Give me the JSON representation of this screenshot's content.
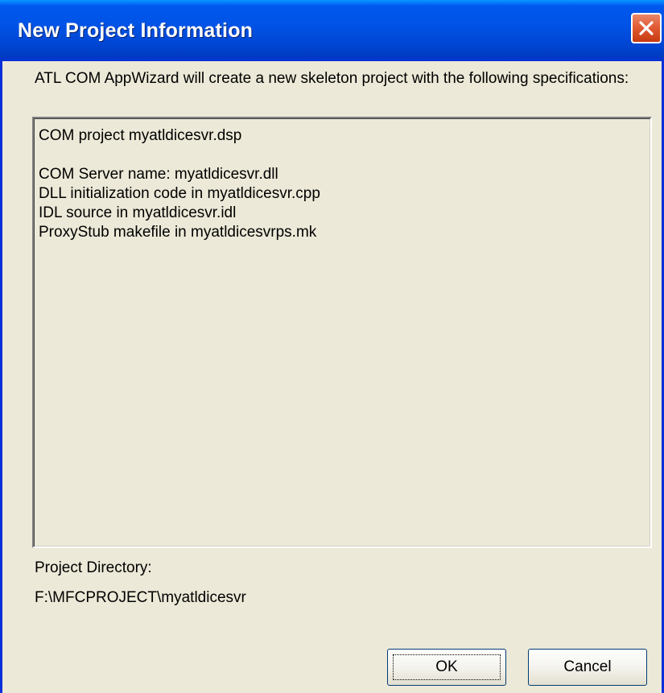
{
  "window": {
    "title": "New Project Information",
    "close_icon": "close-icon"
  },
  "intro_text": "ATL COM AppWizard will create a new skeleton project with the following specifications:",
  "specifications": {
    "lines": [
      "COM project myatldicesvr.dsp",
      "",
      "COM Server name: myatldicesvr.dll",
      "DLL initialization code in myatldicesvr.cpp",
      "IDL source in myatldicesvr.idl",
      "ProxyStub makefile in myatldicesvrps.mk"
    ]
  },
  "project_directory": {
    "label": "Project Directory:",
    "value": "F:\\MFCPROJECT\\myatldicesvr"
  },
  "buttons": {
    "ok_label": "OK",
    "cancel_label": "Cancel"
  },
  "colors": {
    "title_bar": "#0054e3",
    "dialog_background": "#ece9d8",
    "close_button": "#e25c35"
  }
}
